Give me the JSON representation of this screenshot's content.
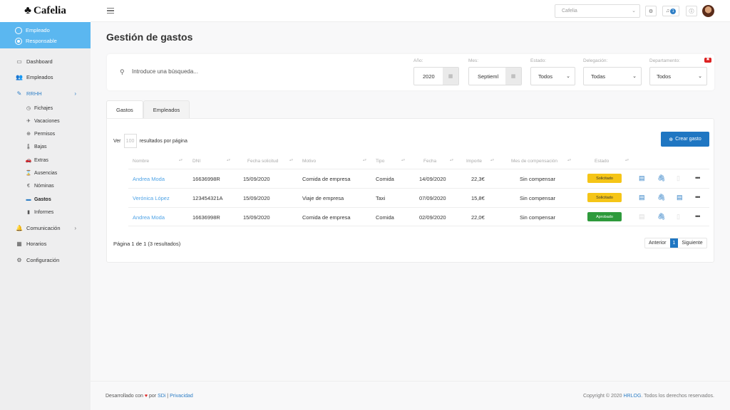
{
  "brand": {
    "name": "Cafelia"
  },
  "sidebar": {
    "roles": [
      {
        "label": "Empleado",
        "selected": false
      },
      {
        "label": "Responsable",
        "selected": true
      }
    ],
    "nav": {
      "dashboard": "Dashboard",
      "empleados": "Empleados",
      "rrhh": "RRHH",
      "fichajes": "Fichajes",
      "vacaciones": "Vacaciones",
      "permisos": "Permisos",
      "bajas": "Bajas",
      "extras": "Extras",
      "ausencias": "Ausencias",
      "nominas": "Nóminas",
      "gastos": "Gastos",
      "informes": "Informes",
      "comunicacion": "Comunicación",
      "horarios": "Horarios",
      "configuracion": "Configuración"
    }
  },
  "topbar": {
    "company": "Cafelia",
    "notification_count": "1"
  },
  "page": {
    "title": "Gestión de gastos"
  },
  "filters": {
    "search_placeholder": "Introduce una búsqueda...",
    "year_label": "Año:",
    "year_value": "2020",
    "month_label": "Mes:",
    "month_value": "Septieml",
    "estado_label": "Estado:",
    "estado_value": "Todos",
    "delegacion_label": "Delegación:",
    "delegacion_value": "Todas",
    "departamento_label": "Departamento:",
    "departamento_value": "Todos"
  },
  "tabs": [
    "Gastos",
    "Empleados"
  ],
  "table": {
    "per_page_prefix": "Ver",
    "per_page_value": "100",
    "per_page_suffix": "resultados por página",
    "create_label": "Crear gasto",
    "headers": [
      "Nombre",
      "DNI",
      "Fecha solicitud",
      "Motivo",
      "Tipo",
      "Fecha",
      "Importe",
      "Mes de compensación",
      "Estado"
    ],
    "rows": [
      {
        "nombre": "Andrea Moda",
        "dni": "16636998R",
        "fecha_solicitud": "15/09/2020",
        "motivo": "Comida de empresa",
        "tipo": "Comida",
        "fecha": "14/09/2020",
        "importe": "22,3€",
        "mes": "Sin compensar",
        "estado": "Solicitado"
      },
      {
        "nombre": "Verónica López",
        "dni": "123454321A",
        "fecha_solicitud": "15/09/2020",
        "motivo": "Viaje de empresa",
        "tipo": "Taxi",
        "fecha": "07/09/2020",
        "importe": "15,8€",
        "mes": "Sin compensar",
        "estado": "Solicitado"
      },
      {
        "nombre": "Andrea Moda",
        "dni": "16636998R",
        "fecha_solicitud": "15/09/2020",
        "motivo": "Comida de empresa",
        "tipo": "Comida",
        "fecha": "02/09/2020",
        "importe": "22,0€",
        "mes": "Sin compensar",
        "estado": "Aprobado"
      }
    ],
    "page_info": "Página 1 de 1 (3 resultados)",
    "prev": "Anterior",
    "current_page": "1",
    "next": "Siguiente"
  },
  "footer": {
    "dev_prefix": "Desarrollado con",
    "dev_by": "por",
    "sdi": "SDi",
    "sep": "|",
    "privacy": "Privacidad",
    "copyright_prefix": "Copyright © 2020",
    "hrlog": "HRLOG",
    "copyright_suffix": ". Todos los derechos reservados."
  },
  "colors": {
    "accent": "#1f76c2",
    "sidebar_role_bg": "#5bb7f0",
    "solicitado": "#f5c517",
    "aprobado": "#2e9a3c"
  }
}
